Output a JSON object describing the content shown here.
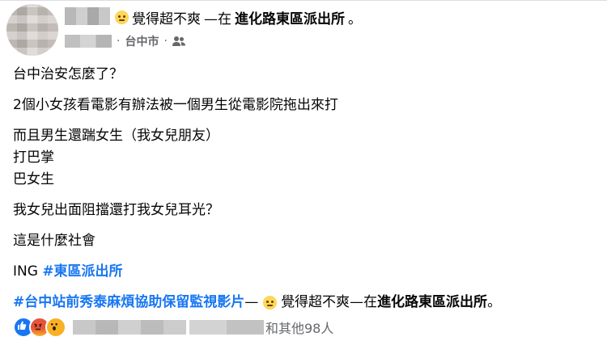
{
  "header": {
    "feeling_text": "覺得超不爽",
    "dash_at": "—在",
    "location": "進化路東區派出所",
    "period": "。",
    "sub_location": "台中市",
    "sub_separator": "·"
  },
  "post": {
    "lines": [
      "台中治安怎麼了？",
      "2個小女孩看電影有辦法被一個男生從電影院拖出來打",
      "而且男生還踹女生（我女兒朋友）",
      "打巴掌",
      "巴女生",
      "我女兒出面阻擋還打我女兒耳光？",
      "這是什麼社會"
    ],
    "ing_prefix": "ING ",
    "ing_hashtag": "#東區派出所",
    "footer_hashtag": "#台中站前秀泰麻煩協助保留監視影片",
    "footer_dash": "—",
    "footer_feeling": "覺得超不爽",
    "footer_at": "—在",
    "footer_location": "進化路東區派出所",
    "footer_period": "。"
  },
  "reactions": {
    "icons": [
      "like-reaction",
      "angry-reaction",
      "wow-reaction"
    ],
    "summary": "和其他98人"
  },
  "colors": {
    "link": "#1877f2",
    "secondary_text": "#65676b",
    "primary_text": "#050505"
  }
}
